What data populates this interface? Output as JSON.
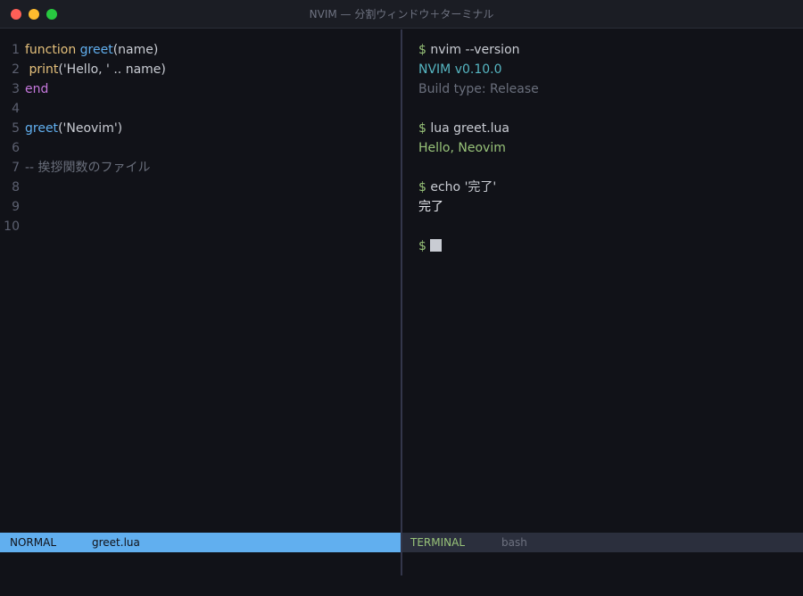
{
  "window": {
    "title": "NVIM — 分割ウィンドウ＋ターミナル"
  },
  "editor": {
    "line_numbers": [
      "1",
      "2",
      "3",
      "4",
      "5",
      "6",
      "7",
      "8",
      "9",
      "10"
    ],
    "line1": {
      "kw": "function",
      "fn": "greet",
      "rest": "(name)"
    },
    "line2": {
      "indent": " ",
      "call": "print",
      "rest": "('Hello, ' .. name)"
    },
    "line3": {
      "kw": "end"
    },
    "line5": {
      "fn": "greet",
      "rest": "('Neovim')"
    },
    "line7": {
      "comment": "-- 挨拶関数のファイル"
    }
  },
  "terminal": {
    "prompt": "$",
    "lines": [
      {
        "cmd": "nvim --version"
      },
      {
        "out": "NVIM v0.10.0"
      },
      {
        "out": "Build type: Release"
      },
      {
        "cmd": "lua greet.lua"
      },
      {
        "out": "Hello, Neovim"
      },
      {
        "cmd": "echo '完了'"
      },
      {
        "out": "完了"
      }
    ]
  },
  "status": {
    "left_mode": "NORMAL",
    "left_file": "greet.lua",
    "right_mode": "TERMINAL",
    "right_name": "bash"
  },
  "colors": {
    "accent": "#61afef",
    "background": "#111218"
  }
}
